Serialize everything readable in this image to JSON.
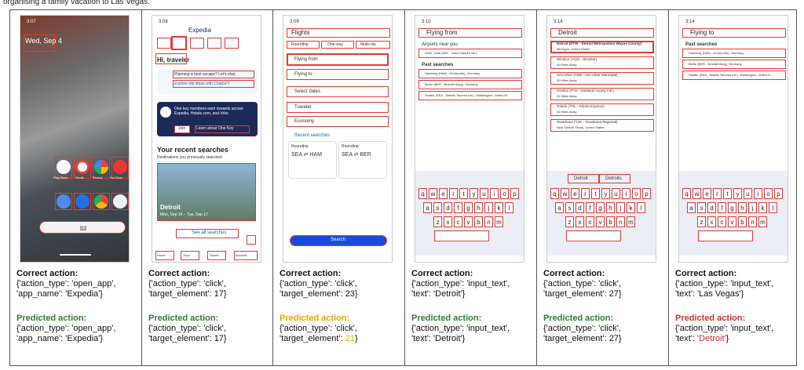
{
  "caption": "organising a family vacation to Las Vegas.",
  "colors": {
    "correct": "#111111",
    "predicted_ok": "#2e7d32",
    "predicted_partial": "#f4a300",
    "predicted_wrong": "#d32f2f",
    "box": "#e53935"
  },
  "labels": {
    "correct": "Correct action:",
    "predicted": "Predicted action:"
  },
  "panels": [
    {
      "correct": [
        "{'action_type': 'open_app',",
        "'app_name': 'Expedia'}"
      ],
      "predicted_pre": [
        "{'action_type': 'open_app',",
        "'app_name': 'Expedia'}"
      ],
      "screen": {
        "time": "3:07",
        "date": "Wed, Sep 4",
        "apps": [
          "Play Store",
          "Gmail",
          "Photos",
          "YouTube"
        ]
      }
    },
    {
      "correct": [
        "{'action_type': 'click',",
        "'target_element': 17}"
      ],
      "predicted_pre": [
        "{'action_type': 'click',",
        "'target_element': 17}"
      ],
      "screen": {
        "time": "3:08",
        "brand": "Expedia",
        "greeting": "Hi, traveler",
        "promo_title": "Planning a next escape? Let's chat.",
        "promo_link": "Explore trip ideas with ChatGPT",
        "rewards_text": "One key members earn rewards across Expedia, Hotels.com, and Vrbo",
        "join_btn": "Join",
        "learn_link": "Learn about One Key",
        "recent_title": "Your recent searches",
        "recent_sub": "Destinations you previously searched",
        "dest_name": "Detroit",
        "dest_dates": "Mon, Sep 16 – Tue, Sep 17",
        "see_all": "See all searches",
        "nav": [
          "Home",
          "Trips",
          "Saved",
          "Account"
        ]
      }
    },
    {
      "correct": [
        "{'action_type': 'click',",
        "'target_element': 23}"
      ],
      "predicted_pre": [
        "{'action_type': 'click',",
        "'target_element': "
      ],
      "predicted_hl": "21",
      "predicted_post": "}",
      "screen": {
        "time": "3:09",
        "title": "Flights",
        "tabs": [
          "Roundtrip",
          "One-way",
          "Multi-city"
        ],
        "fields": [
          "Flying from",
          "Flying to",
          "Select dates",
          "Traveler",
          "Economy"
        ],
        "recent": "Recent searches",
        "cards": [
          {
            "type": "Roundtrip",
            "route": "SEA ⇄ HAM"
          },
          {
            "type": "Roundtrip",
            "route": "SEA ⇄ BER"
          }
        ],
        "search": "Search"
      }
    },
    {
      "correct": [
        "{'action_type': 'input_text',",
        "'text': 'Detroit'}"
      ],
      "predicted_pre": [
        "{'action_type': 'input_text',",
        "'text': 'Detroit'}"
      ],
      "screen": {
        "time": "3:10",
        "field": "Flying from",
        "near": "Airports near you",
        "airport": "Delhi, India (DEL - Indira Gandhi Intl.)",
        "past": "Past searches",
        "items": [
          "Hamburg (HAM - All Airports), Germany",
          "Berlin (BER - Brandenburg), Germany",
          "Seattle (SEA - Seattle-Tacoma Intl.), Washington, United St..."
        ]
      }
    },
    {
      "correct": [
        "{'action_type': 'click',",
        "'target_element': 27}"
      ],
      "predicted_pre": [
        "{'action_type': 'click',",
        "'target_element': 27}"
      ],
      "screen": {
        "time": "3:14",
        "field": "Detroit",
        "results": [
          {
            "name": "Detroit (DTW - Detroit Metropolitan Wayne County)",
            "sub": "Michigan, United States"
          },
          {
            "name": "Windsor (YQG - Windsor)",
            "sub": "20 Miles Away"
          },
          {
            "name": "Ann Arbor (ARB - Ann Arbor Municipal)",
            "sub": "20 Miles Away"
          },
          {
            "name": "Pontiac (PTK - Oakland County Intl.)",
            "sub": "31 Miles Away"
          },
          {
            "name": "Toledo (TOL - Toledo Express)",
            "sub": "46 Miles Away"
          },
          {
            "name": "Texarkana (TXK - Texarkana Regional)",
            "sub": "Near Detroit, Texas, United States"
          }
        ],
        "suggest": [
          "Detroit",
          "Detroits"
        ]
      }
    },
    {
      "correct": [
        "{'action_type': 'input_text',",
        "'text': 'Las Vegas'}"
      ],
      "predicted_pre": [
        "{'action_type': 'input_text',",
        "'text': "
      ],
      "predicted_hl": "'Detroit'",
      "predicted_post": "}",
      "screen": {
        "time": "3:14",
        "field": "Flying to",
        "past": "Past searches",
        "items": [
          "Hamburg (HAM - All Airports), Germany",
          "Berlin (BER - Brandenburg), Germany",
          "Seattle (SEA - Seattle-Tacoma Intl.), Washington, United S..."
        ]
      }
    }
  ]
}
